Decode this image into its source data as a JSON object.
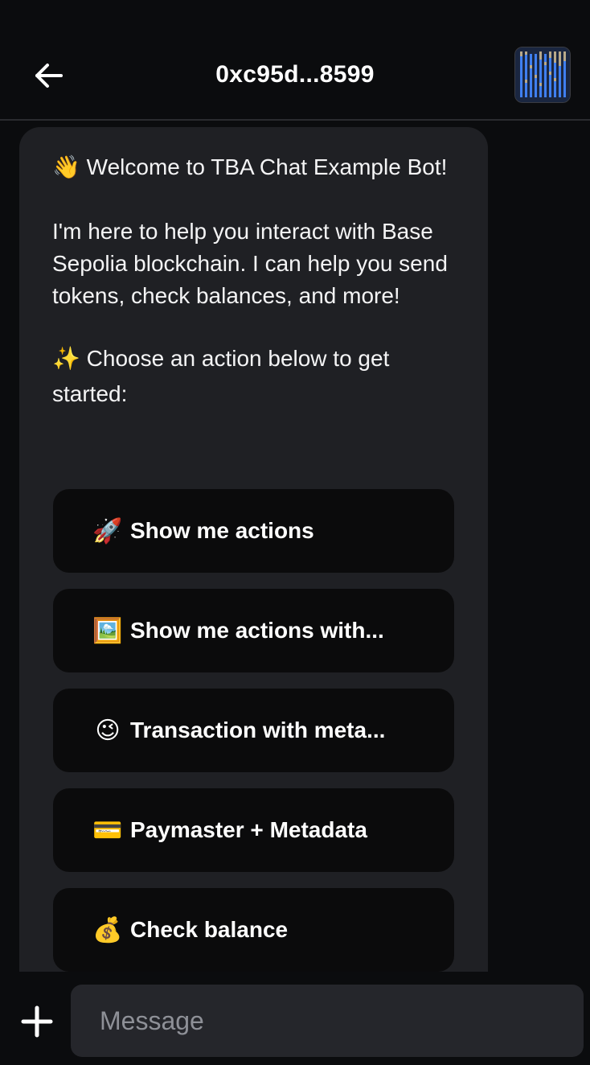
{
  "header": {
    "title": "0xc95d...8599",
    "back_icon": "arrow-left-icon",
    "avatar_icon": "pixel-art-avatar"
  },
  "message": {
    "welcome_emoji": "👋",
    "welcome_text": "Welcome to TBA Chat Example Bot!",
    "body_text": "I'm here to help you interact with Base Sepolia blockchain. I can help you send tokens, check balances, and more!",
    "prompt_emoji": "✨",
    "prompt_text": "Choose an action below to get started:",
    "actions": [
      {
        "emoji": "🚀",
        "label": "Show me actions"
      },
      {
        "emoji": "🖼️",
        "label": "Show me actions with..."
      },
      {
        "emoji": "😉",
        "label": "Transaction with meta..."
      },
      {
        "emoji": "💳",
        "label": "Paymaster + Metadata"
      },
      {
        "emoji": "💰",
        "label": "Check balance"
      }
    ]
  },
  "composer": {
    "placeholder": "Message",
    "plus_icon": "plus-icon"
  },
  "colors": {
    "background": "#0b0c0e",
    "bubble": "#1f2024",
    "action_button": "#0b0b0c",
    "input": "#25262b",
    "placeholder": "#8e9097"
  }
}
